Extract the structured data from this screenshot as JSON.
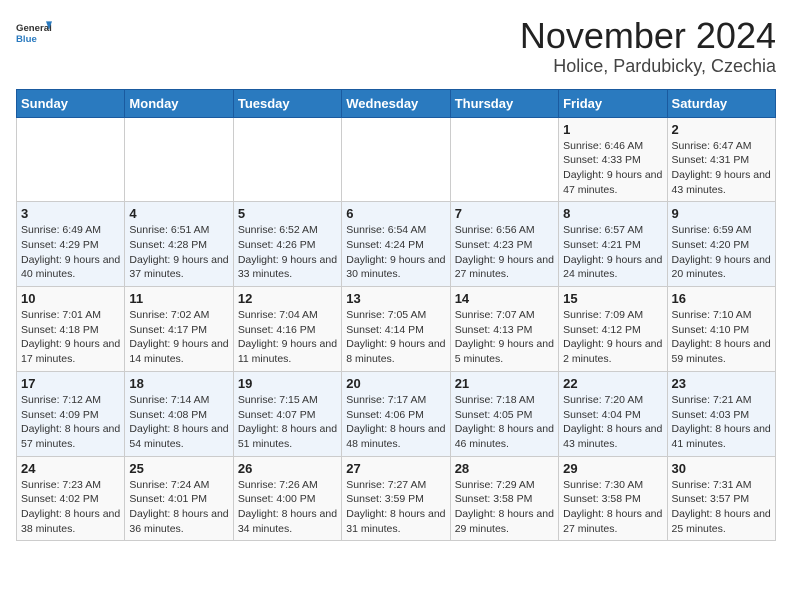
{
  "logo": {
    "text_general": "General",
    "text_blue": "Blue"
  },
  "title": "November 2024",
  "subtitle": "Holice, Pardubicky, Czechia",
  "weekdays": [
    "Sunday",
    "Monday",
    "Tuesday",
    "Wednesday",
    "Thursday",
    "Friday",
    "Saturday"
  ],
  "weeks": [
    [
      {
        "day": "",
        "info": ""
      },
      {
        "day": "",
        "info": ""
      },
      {
        "day": "",
        "info": ""
      },
      {
        "day": "",
        "info": ""
      },
      {
        "day": "",
        "info": ""
      },
      {
        "day": "1",
        "info": "Sunrise: 6:46 AM\nSunset: 4:33 PM\nDaylight: 9 hours and 47 minutes."
      },
      {
        "day": "2",
        "info": "Sunrise: 6:47 AM\nSunset: 4:31 PM\nDaylight: 9 hours and 43 minutes."
      }
    ],
    [
      {
        "day": "3",
        "info": "Sunrise: 6:49 AM\nSunset: 4:29 PM\nDaylight: 9 hours and 40 minutes."
      },
      {
        "day": "4",
        "info": "Sunrise: 6:51 AM\nSunset: 4:28 PM\nDaylight: 9 hours and 37 minutes."
      },
      {
        "day": "5",
        "info": "Sunrise: 6:52 AM\nSunset: 4:26 PM\nDaylight: 9 hours and 33 minutes."
      },
      {
        "day": "6",
        "info": "Sunrise: 6:54 AM\nSunset: 4:24 PM\nDaylight: 9 hours and 30 minutes."
      },
      {
        "day": "7",
        "info": "Sunrise: 6:56 AM\nSunset: 4:23 PM\nDaylight: 9 hours and 27 minutes."
      },
      {
        "day": "8",
        "info": "Sunrise: 6:57 AM\nSunset: 4:21 PM\nDaylight: 9 hours and 24 minutes."
      },
      {
        "day": "9",
        "info": "Sunrise: 6:59 AM\nSunset: 4:20 PM\nDaylight: 9 hours and 20 minutes."
      }
    ],
    [
      {
        "day": "10",
        "info": "Sunrise: 7:01 AM\nSunset: 4:18 PM\nDaylight: 9 hours and 17 minutes."
      },
      {
        "day": "11",
        "info": "Sunrise: 7:02 AM\nSunset: 4:17 PM\nDaylight: 9 hours and 14 minutes."
      },
      {
        "day": "12",
        "info": "Sunrise: 7:04 AM\nSunset: 4:16 PM\nDaylight: 9 hours and 11 minutes."
      },
      {
        "day": "13",
        "info": "Sunrise: 7:05 AM\nSunset: 4:14 PM\nDaylight: 9 hours and 8 minutes."
      },
      {
        "day": "14",
        "info": "Sunrise: 7:07 AM\nSunset: 4:13 PM\nDaylight: 9 hours and 5 minutes."
      },
      {
        "day": "15",
        "info": "Sunrise: 7:09 AM\nSunset: 4:12 PM\nDaylight: 9 hours and 2 minutes."
      },
      {
        "day": "16",
        "info": "Sunrise: 7:10 AM\nSunset: 4:10 PM\nDaylight: 8 hours and 59 minutes."
      }
    ],
    [
      {
        "day": "17",
        "info": "Sunrise: 7:12 AM\nSunset: 4:09 PM\nDaylight: 8 hours and 57 minutes."
      },
      {
        "day": "18",
        "info": "Sunrise: 7:14 AM\nSunset: 4:08 PM\nDaylight: 8 hours and 54 minutes."
      },
      {
        "day": "19",
        "info": "Sunrise: 7:15 AM\nSunset: 4:07 PM\nDaylight: 8 hours and 51 minutes."
      },
      {
        "day": "20",
        "info": "Sunrise: 7:17 AM\nSunset: 4:06 PM\nDaylight: 8 hours and 48 minutes."
      },
      {
        "day": "21",
        "info": "Sunrise: 7:18 AM\nSunset: 4:05 PM\nDaylight: 8 hours and 46 minutes."
      },
      {
        "day": "22",
        "info": "Sunrise: 7:20 AM\nSunset: 4:04 PM\nDaylight: 8 hours and 43 minutes."
      },
      {
        "day": "23",
        "info": "Sunrise: 7:21 AM\nSunset: 4:03 PM\nDaylight: 8 hours and 41 minutes."
      }
    ],
    [
      {
        "day": "24",
        "info": "Sunrise: 7:23 AM\nSunset: 4:02 PM\nDaylight: 8 hours and 38 minutes."
      },
      {
        "day": "25",
        "info": "Sunrise: 7:24 AM\nSunset: 4:01 PM\nDaylight: 8 hours and 36 minutes."
      },
      {
        "day": "26",
        "info": "Sunrise: 7:26 AM\nSunset: 4:00 PM\nDaylight: 8 hours and 34 minutes."
      },
      {
        "day": "27",
        "info": "Sunrise: 7:27 AM\nSunset: 3:59 PM\nDaylight: 8 hours and 31 minutes."
      },
      {
        "day": "28",
        "info": "Sunrise: 7:29 AM\nSunset: 3:58 PM\nDaylight: 8 hours and 29 minutes."
      },
      {
        "day": "29",
        "info": "Sunrise: 7:30 AM\nSunset: 3:58 PM\nDaylight: 8 hours and 27 minutes."
      },
      {
        "day": "30",
        "info": "Sunrise: 7:31 AM\nSunset: 3:57 PM\nDaylight: 8 hours and 25 minutes."
      }
    ]
  ]
}
